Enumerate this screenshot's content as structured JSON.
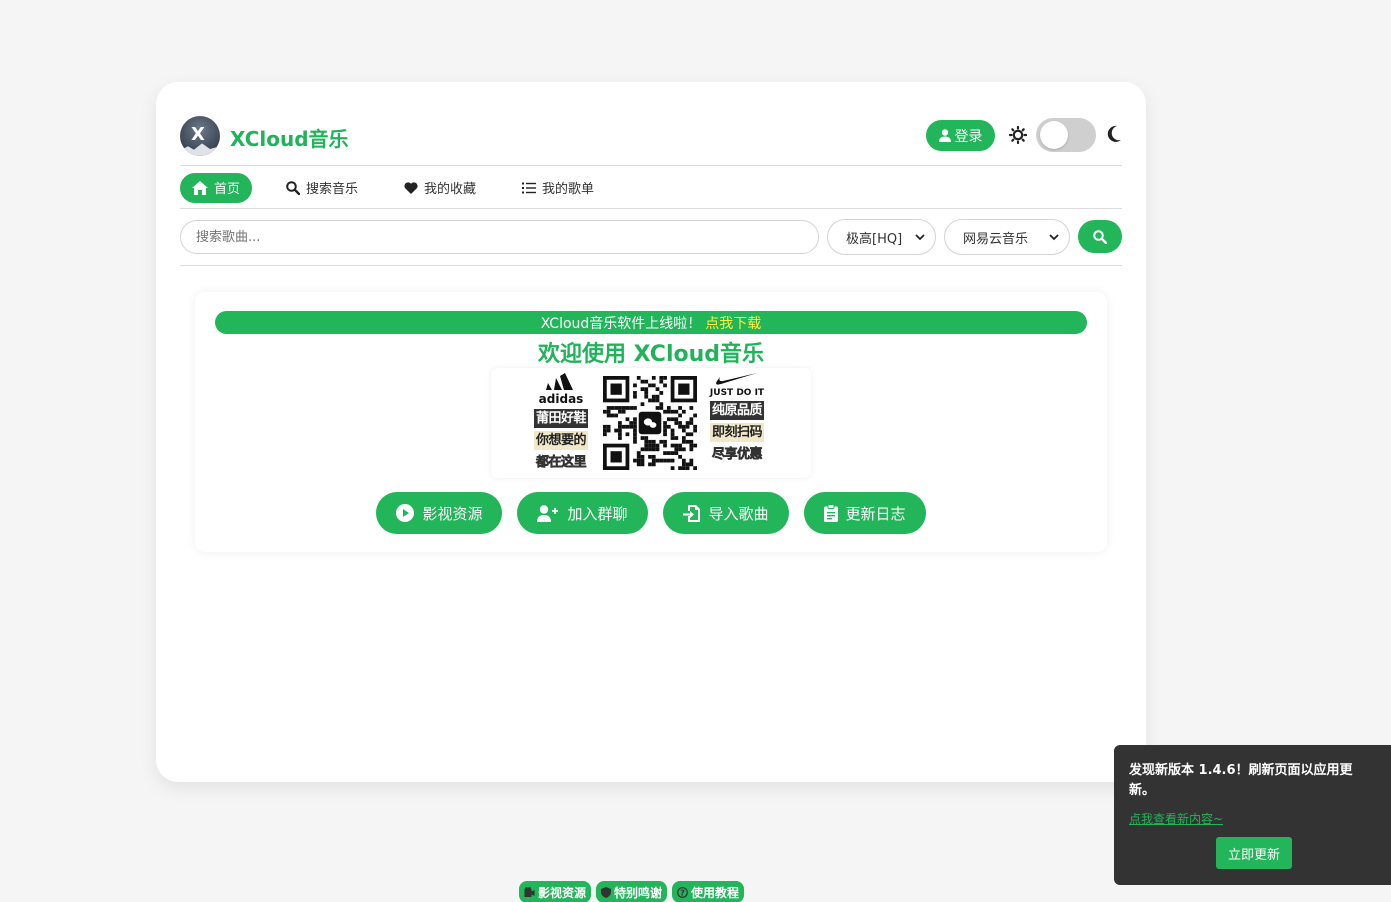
{
  "app": {
    "brand": "XCloud音乐"
  },
  "header": {
    "login_label": "登录"
  },
  "nav": {
    "items": [
      {
        "label": "首页",
        "icon": "home-icon",
        "active": true
      },
      {
        "label": "搜索音乐",
        "icon": "search-icon",
        "active": false
      },
      {
        "label": "我的收藏",
        "icon": "heart-icon",
        "active": false
      },
      {
        "label": "我的歌单",
        "icon": "list-icon",
        "active": false
      }
    ]
  },
  "search": {
    "placeholder": "搜索歌曲...",
    "quality": "极高[HQ]",
    "source": "网易云音乐"
  },
  "panel": {
    "banner_text": "XCloud音乐软件上线啦！",
    "banner_link": "点我下载",
    "welcome": "欢迎使用 XCloud音乐",
    "ad": {
      "left_brand": "adidas",
      "left_lines": [
        "莆田好鞋",
        "你想要的",
        "都在这里"
      ],
      "right_brand": "JUST DO IT",
      "right_lines": [
        "纯原品质",
        "即刻扫码",
        "尽享优惠"
      ]
    },
    "actions": [
      {
        "label": "影视资源",
        "icon": "play-circle-icon"
      },
      {
        "label": "加入群聊",
        "icon": "user-plus-icon"
      },
      {
        "label": "导入歌曲",
        "icon": "file-import-icon"
      },
      {
        "label": "更新日志",
        "icon": "clipboard-icon"
      }
    ]
  },
  "footer": {
    "links": [
      {
        "label": "影视资源",
        "icon": "film-icon"
      },
      {
        "label": "特别鸣谢",
        "icon": "shield-icon"
      },
      {
        "label": "使用教程",
        "icon": "question-circle-icon"
      }
    ]
  },
  "toast": {
    "message": "发现新版本 1.4.6！刷新页面以应用更新。",
    "link": "点我查看新内容~",
    "update_button": "立即更新"
  },
  "colors": {
    "accent": "#22b55a",
    "toast_bg": "#333333",
    "banner_highlight": "#ffef3d"
  }
}
